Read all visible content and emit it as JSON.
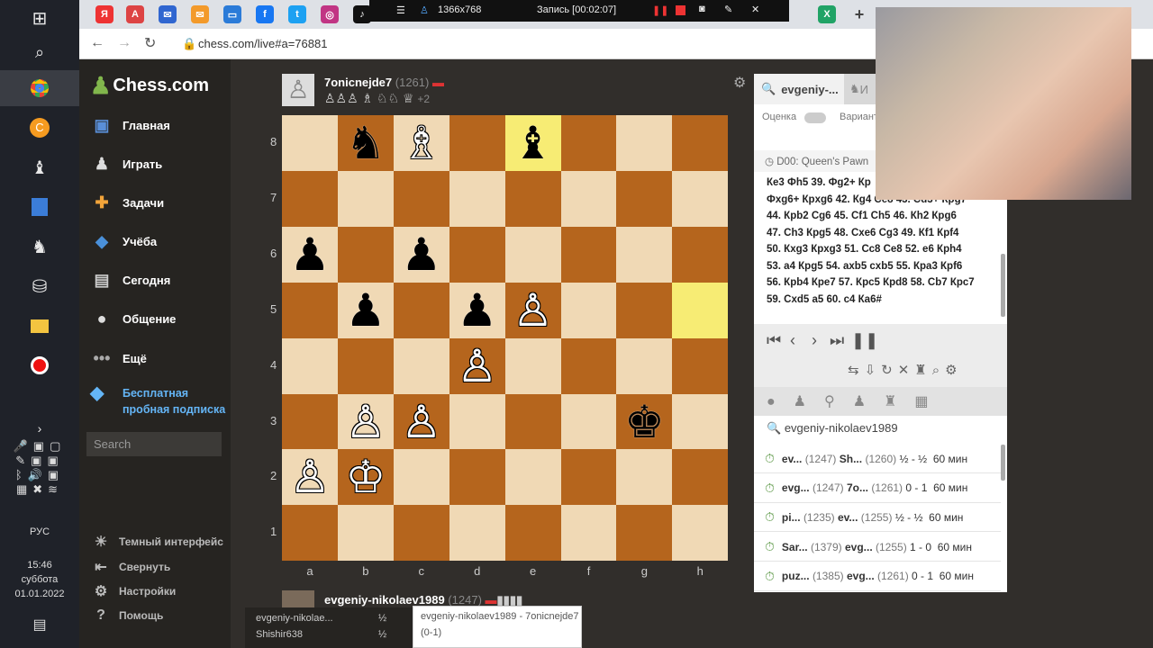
{
  "recorder": {
    "resolution": "1366x768",
    "status": "Запись [00:02:07]"
  },
  "browser": {
    "url": "chess.com/live#a=76881"
  },
  "site": {
    "logo": "Chess.com",
    "nav": [
      "Главная",
      "Играть",
      "Задачи",
      "Учёба",
      "Сегодня",
      "Общение",
      "Ещё"
    ],
    "promo_line1": "Бесплатная",
    "promo_line2": "пробная подписка",
    "search_placeholder": "Search",
    "bottom_nav": [
      "Темный интерфейс",
      "Свернуть",
      "Настройки",
      "Помощь"
    ]
  },
  "top_player": {
    "name": "7onicnejde7",
    "rating": "(1261)",
    "captured_extra": "+2"
  },
  "bottom_player": {
    "name": "evgeniy-nikolaev1989",
    "rating": "(1247)"
  },
  "board": {
    "ranks": [
      "8",
      "7",
      "6",
      "5",
      "4",
      "3",
      "2",
      "1"
    ],
    "files": [
      "a",
      "b",
      "c",
      "d",
      "e",
      "f",
      "g",
      "h"
    ]
  },
  "panel": {
    "tab1": "evgeniy-...",
    "tab2": "И",
    "eval_label": "Оценка",
    "variant_label": "Вариант",
    "opening": "D00: Queen's Pawn",
    "moves": [
      "Ке3 Фh5 39. Фg2+ Кр",
      "Фxg6+ Крxg6 42. Кg4 Се8 43. Сd3+ Крg7",
      "44. Крb2 Сg6 45. Сf1 Сh5 46. Кh2 Крg6",
      "47. Сh3 Крg5 48. Сxе6 Сg3 49. Кf1 Крf4",
      "50. Кxg3 Крxg3 51. Сс8 Се8 52. е6 Крh4",
      "53. а4 Крg5 54. аxb5 сxb5 55. Кра3 Крf6",
      "56. Крb4 Кре7 57. Крс5 Крd8 58. Сb7 Крс7",
      "59. Сxd5 а5 60. с4 Кa6#"
    ],
    "search_value": "evgeniy-nikolaev1989",
    "games": [
      {
        "p1": "ev...",
        "r1": "(1247)",
        "p2": "Sh...",
        "r2": "(1260)",
        "result": "½ - ½",
        "time": "60 мин"
      },
      {
        "p1": "evg...",
        "r1": "(1247)",
        "p2": "7o...",
        "r2": "(1261)",
        "result": "0 - 1",
        "time": "60 мин"
      },
      {
        "p1": "pi...",
        "r1": "(1235)",
        "p2": "ev...",
        "r2": "(1255)",
        "result": "½ - ½",
        "time": "60 мин"
      },
      {
        "p1": "Sar...",
        "r1": "(1379)",
        "p2": "evg...",
        "r2": "(1255)",
        "result": "1 - 0",
        "time": "60 мин"
      },
      {
        "p1": "puz...",
        "r1": "(1385)",
        "p2": "evg...",
        "r2": "(1261)",
        "result": "0 - 1",
        "time": "60 мин"
      }
    ]
  },
  "tooltip": {
    "line1": "evgeniy-nikolaev1989 - 7onicnejde7",
    "line2": "(0-1)"
  },
  "popup": {
    "row1_name": "evgeniy-nikolae...",
    "row1_score": "½",
    "row2_name": "Shishir638",
    "row2_score": "½"
  },
  "tray": {
    "lang": "РУС",
    "time": "15:46",
    "day": "суббота",
    "date": "01.01.2022"
  }
}
